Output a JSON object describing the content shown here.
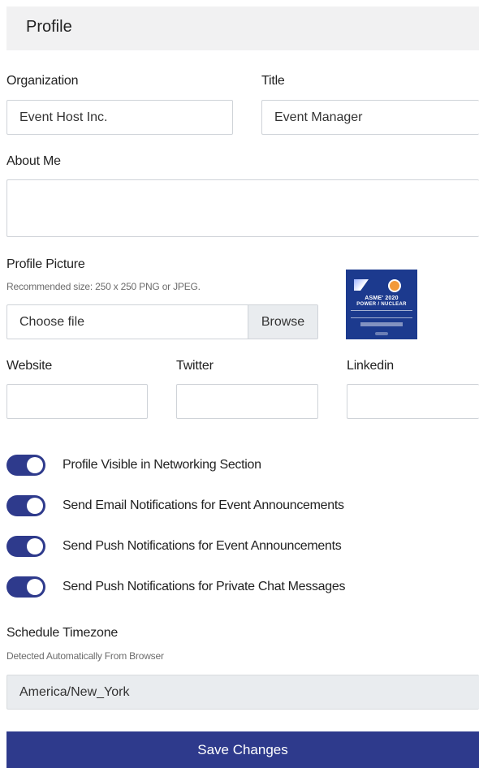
{
  "header": {
    "title": "Profile"
  },
  "organization": {
    "label": "Organization",
    "value": "Event Host Inc."
  },
  "title_field": {
    "label": "Title",
    "value": "Event Manager"
  },
  "about": {
    "label": "About Me",
    "value": ""
  },
  "picture": {
    "label": "Profile Picture",
    "hint": "Recommended size: 250 x 250 PNG or JPEG.",
    "file_placeholder": "Choose file",
    "browse_label": "Browse",
    "thumbnail": {
      "line1": "ASME' 2020",
      "line2": "POWER / NUCLEAR"
    }
  },
  "social": {
    "website_label": "Website",
    "twitter_label": "Twitter",
    "linkedin_label": "Linkedin"
  },
  "toggles": [
    {
      "label": "Profile Visible in Networking Section",
      "on": true
    },
    {
      "label": "Send Email Notifications for Event Announcements",
      "on": true
    },
    {
      "label": "Send Push Notifications for Event Announcements",
      "on": true
    },
    {
      "label": "Send Push Notifications for Private Chat Messages",
      "on": true
    }
  ],
  "timezone": {
    "label": "Schedule Timezone",
    "hint": "Detected Automatically From Browser",
    "value": "America/New_York"
  },
  "save_label": "Save Changes",
  "colors": {
    "accent": "#2e3a8c",
    "header_bg": "#f1f1f2",
    "border": "#cfd3d8",
    "disabled_bg": "#e9ecef"
  }
}
